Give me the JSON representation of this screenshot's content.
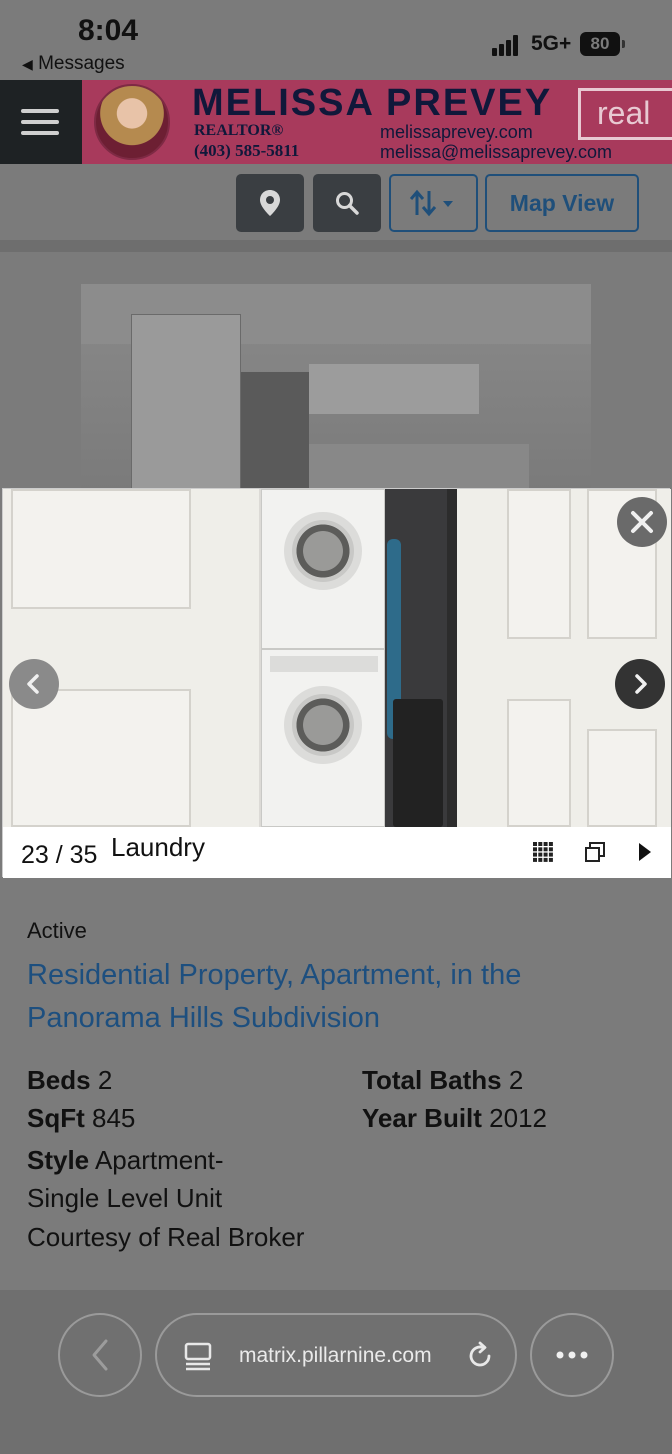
{
  "status_bar": {
    "time": "8:04",
    "back_app": "Messages",
    "network": "5G+",
    "battery": "80"
  },
  "banner": {
    "name": "MELISSA PREVEY",
    "role": "REALTOR®",
    "phone": "(403) 585-5811",
    "website": "melissaprevey.com",
    "email": "melissa@melissaprevey.com",
    "brand": "real"
  },
  "toolbar": {
    "map_view_label": "Map View",
    "location_icon": "location-pin-icon",
    "search_icon": "search-icon",
    "sort_icon": "sort-icon"
  },
  "lightbox": {
    "counter": "23 / 35",
    "caption": "Laundry"
  },
  "listing": {
    "status": "Active",
    "title": "Residential Property, Apartment, in the Panorama Hills Subdivision",
    "beds_label": "Beds",
    "beds": "2",
    "total_baths_label": "Total Baths",
    "total_baths": "2",
    "sqft_label": "SqFt",
    "sqft": "845",
    "year_built_label": "Year Built",
    "year_built": "2012",
    "style_label": "Style",
    "style": "Apartment-Single Level Unit",
    "courtesy": "Courtesy of Real Broker"
  },
  "browser": {
    "url": "matrix.pillarnine.com"
  },
  "colors": {
    "link_blue": "#1d4f7f",
    "banner_pink": "#a83a5c",
    "banner_navy": "#10183a"
  }
}
